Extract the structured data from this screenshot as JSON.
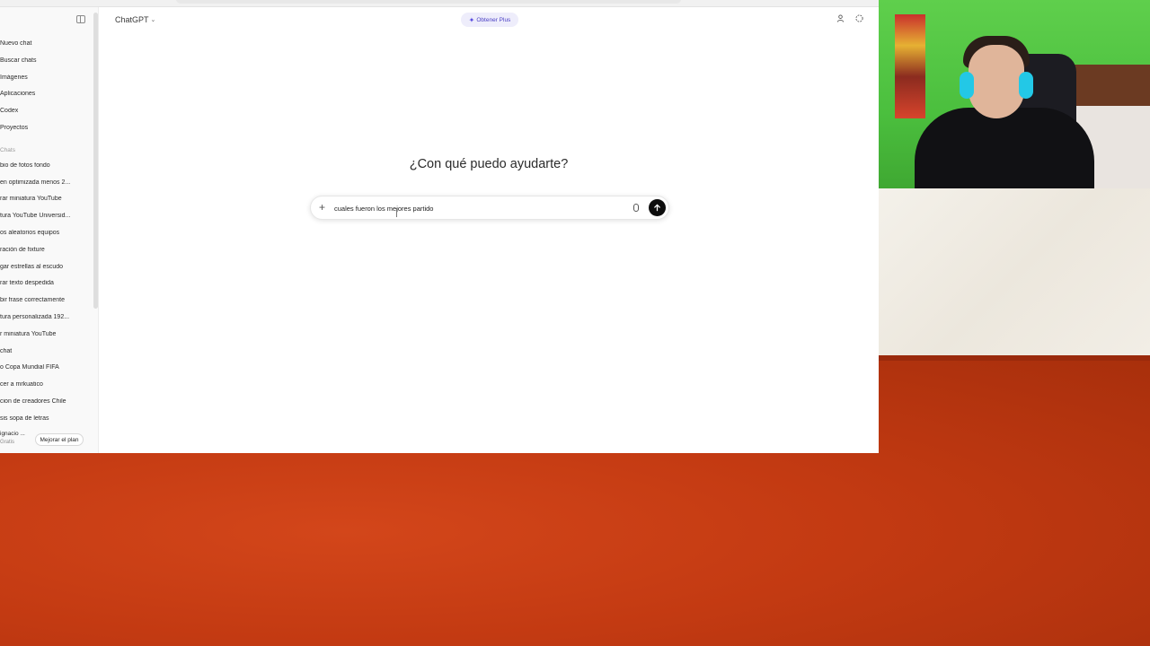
{
  "sidebar": {
    "nav": [
      {
        "label": "Nuevo chat"
      },
      {
        "label": "Buscar chats"
      },
      {
        "label": "Imágenes"
      },
      {
        "label": "Aplicaciones"
      },
      {
        "label": "Codex"
      },
      {
        "label": "Proyectos"
      }
    ],
    "section_label": "Chats",
    "chats": [
      "bio de fotos fondo",
      "en optimizada menos 2...",
      "rar miniatura YouTube",
      "tura YouTube Universid...",
      "os aleatorios equipos",
      "ración de fixture",
      "gar estrellas al escudo",
      "rar texto despedida",
      "bir frase correctamente",
      "tura personalizada 192...",
      "r miniatura YouTube",
      "chat",
      "o Copa Mundial FIFA",
      "cer a mrkuatico",
      "cion de creadores Chile",
      "sis sopa de letras"
    ],
    "profile": {
      "name": "ignacio ...",
      "plan": "Gratis"
    },
    "upgrade_label": "Mejorar el plan"
  },
  "header": {
    "model": "ChatGPT",
    "plus_label": "Obtener Plus"
  },
  "main": {
    "headline": "¿Con qué puedo ayudarte?",
    "composer": {
      "value": "cuales fueron los mejores partido"
    }
  }
}
